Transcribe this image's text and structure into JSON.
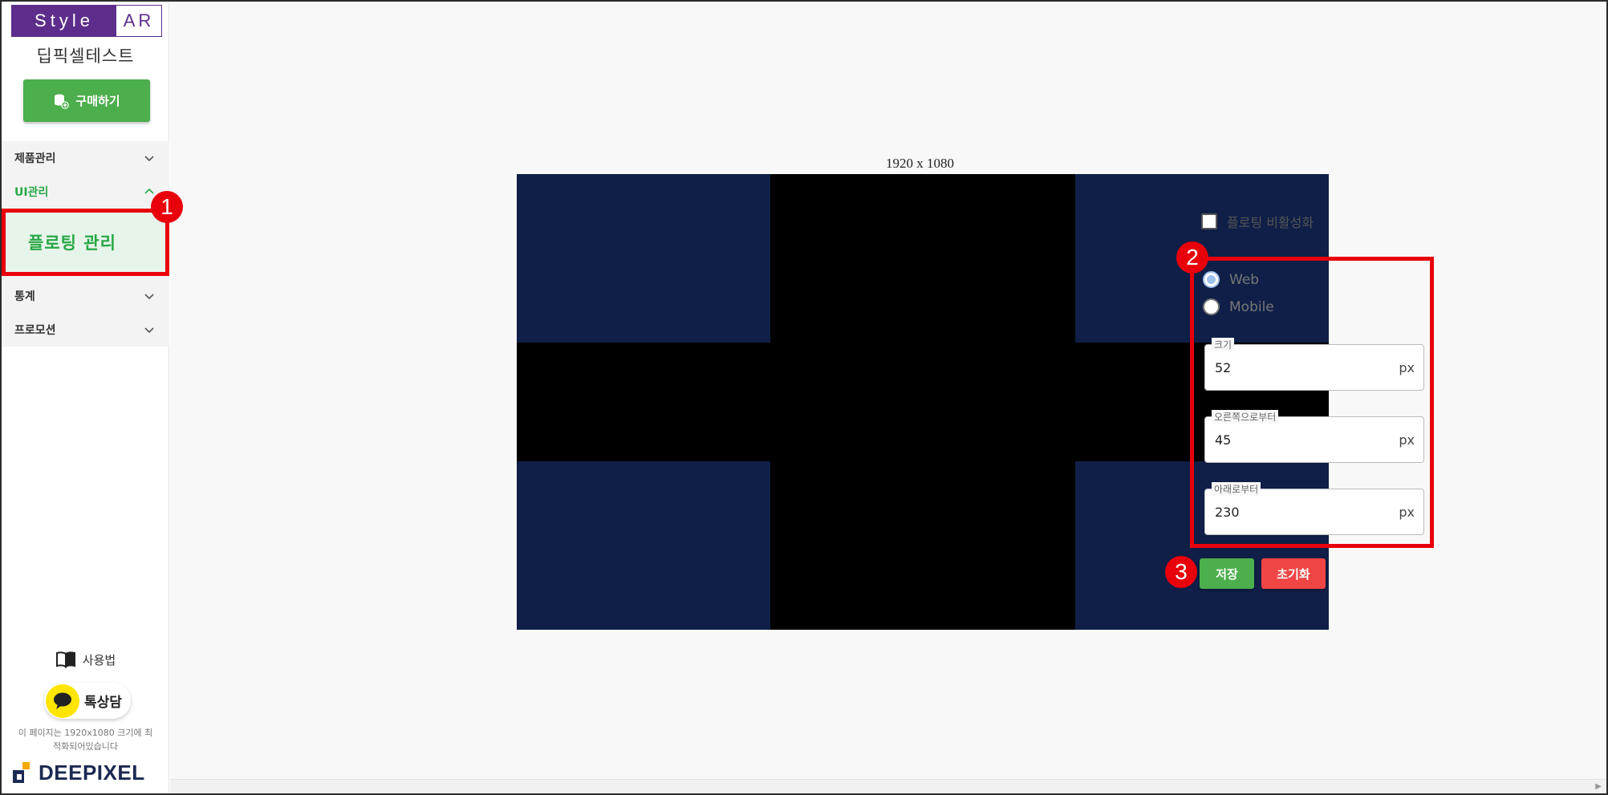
{
  "sidebar": {
    "logo": {
      "left": "Style",
      "right": "AR"
    },
    "shop_name": "딥픽셀테스트",
    "buy_button": "구매하기",
    "menu": [
      {
        "label": "제품관리",
        "expanded": false
      },
      {
        "label": "UI관리",
        "expanded": true,
        "sub": [
          {
            "label": "플로팅 관리",
            "selected": true
          }
        ]
      },
      {
        "label": "통계",
        "expanded": false
      },
      {
        "label": "프로모션",
        "expanded": false
      }
    ],
    "howto": "사용법",
    "kakao": "톡상담",
    "notice": "이 페이지는 1920x1080 크기에 최적화되어있습니다",
    "brand": "DEEPIXEL"
  },
  "main": {
    "resolution": "1920 x 1080",
    "preview": {
      "floating_button_value": "52"
    },
    "disable_floating": {
      "label": "플로팅 비활성화",
      "checked": false
    },
    "device": {
      "options": [
        "Web",
        "Mobile"
      ],
      "selected": "Web"
    },
    "fields": [
      {
        "label": "크기",
        "value": "52",
        "unit": "px"
      },
      {
        "label": "오른쪽으로부터",
        "value": "45",
        "unit": "px"
      },
      {
        "label": "아래로부터",
        "value": "230",
        "unit": "px"
      }
    ],
    "save_button": "저장",
    "reset_button": "초기화"
  },
  "badges": [
    "1",
    "2",
    "3"
  ],
  "colors": {
    "brand_purple": "#5d2d8c",
    "primary_green": "#4cae4c",
    "danger_red": "#f04545",
    "highlight_red": "#e8000b",
    "preview_navy": "#0f1f47",
    "floating_blue": "#3c5db8",
    "kakao_yellow": "#ffe500"
  }
}
